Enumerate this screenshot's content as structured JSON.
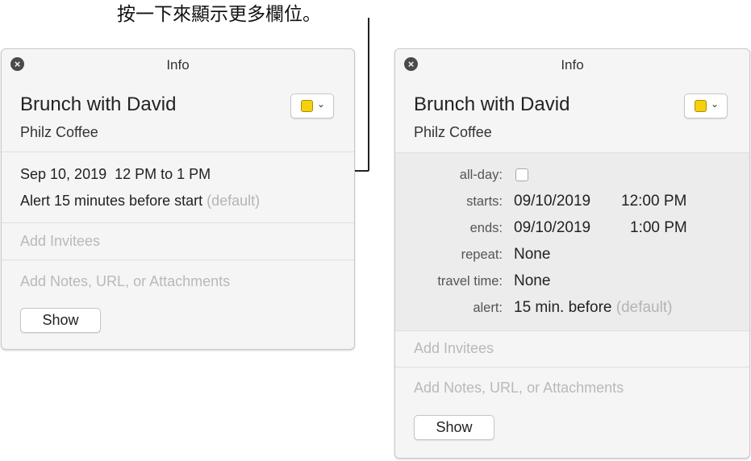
{
  "callout": {
    "text": "按一下來顯示更多欄位。"
  },
  "left_panel": {
    "title": "Info",
    "event_title": "Brunch with David",
    "location": "Philz Coffee",
    "datetime": "Sep 10, 2019  12 PM to 1 PM",
    "alert": "Alert 15 minutes before start",
    "alert_default": "(default)",
    "invitees_placeholder": "Add Invitees",
    "notes_placeholder": "Add Notes, URL, or Attachments",
    "show_label": "Show",
    "calendar_color": "#f5d10c"
  },
  "right_panel": {
    "title": "Info",
    "event_title": "Brunch with David",
    "location": "Philz Coffee",
    "calendar_color": "#f5d10c",
    "fields": {
      "allday_label": "all-day:",
      "allday_checked": false,
      "starts_label": "starts:",
      "starts_date": "09/10/2019",
      "starts_time": "12:00 PM",
      "ends_label": "ends:",
      "ends_date": "09/10/2019",
      "ends_time": "1:00 PM",
      "repeat_label": "repeat:",
      "repeat_value": "None",
      "travel_label": "travel time:",
      "travel_value": "None",
      "alert_label": "alert:",
      "alert_value": "15 min. before",
      "alert_default": "(default)"
    },
    "invitees_placeholder": "Add Invitees",
    "notes_placeholder": "Add Notes, URL, or Attachments",
    "show_label": "Show"
  }
}
